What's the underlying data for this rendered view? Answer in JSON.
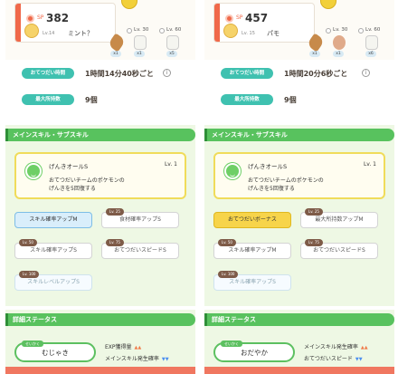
{
  "panels": [
    {
      "header": {
        "sp_label": "SP",
        "sp_value": "382",
        "level": "Lv.14",
        "name": "ミント？"
      },
      "ingredients": [
        {
          "level": "Lv. 30",
          "qty": "x1"
        },
        {
          "level": "Lv. 60",
          "qty": "x5"
        }
      ],
      "first_ingredient_qty": "x1",
      "stats": [
        {
          "label": "おてつだい時間",
          "value": "1時間14分40秒ごと"
        },
        {
          "label": "最大所持数",
          "value": "9個"
        }
      ],
      "skill_section_title": "メインスキル・サブスキル",
      "main_skill": {
        "name": "げんきオールS",
        "level": "Lv. 1",
        "desc1": "おてつだいチームのポケモンの",
        "desc2": "げんきを5回復する"
      },
      "subskills": [
        {
          "tag": "",
          "label": "スキル確率アップM",
          "style": "active-blue"
        },
        {
          "tag": "Lv. 25",
          "label": "食材確率アップS",
          "style": ""
        },
        {
          "tag": "Lv. 50",
          "label": "スキル確率アップS",
          "style": ""
        },
        {
          "tag": "Lv. 75",
          "label": "おてつだいスピードS",
          "style": ""
        },
        {
          "tag": "Lv. 100",
          "label": "スキルレベルアップS",
          "style": "faded"
        }
      ],
      "detail_section_title": "詳細ステータス",
      "nature": {
        "tag": "せいかく",
        "value": "むじゃき"
      },
      "effects": [
        {
          "label": "EXP獲得量",
          "dir": "up"
        },
        {
          "label": "メインスキル発生確率",
          "dir": "down"
        }
      ]
    },
    {
      "header": {
        "sp_label": "SP",
        "sp_value": "457",
        "level": "Lv. 15",
        "name": "パモ"
      },
      "ingredients": [
        {
          "level": "Lv. 30",
          "qty": "x1"
        },
        {
          "level": "Lv. 60",
          "qty": "x6"
        }
      ],
      "first_ingredient_qty": "x1",
      "stats": [
        {
          "label": "おてつだい時間",
          "value": "1時間20分6秒ごと"
        },
        {
          "label": "最大所持数",
          "value": "9個"
        }
      ],
      "skill_section_title": "メインスキル・サブスキル",
      "main_skill": {
        "name": "げんきオールS",
        "level": "Lv. 1",
        "desc1": "おてつだいチームのポケモンの",
        "desc2": "げんきを5回復する"
      },
      "subskills": [
        {
          "tag": "",
          "label": "おてつだいボーナス",
          "style": "active-gold"
        },
        {
          "tag": "Lv. 25",
          "label": "最大所持数アップM",
          "style": ""
        },
        {
          "tag": "Lv. 50",
          "label": "スキル確率アップM",
          "style": ""
        },
        {
          "tag": "Lv. 75",
          "label": "おてつだいスピードS",
          "style": ""
        },
        {
          "tag": "Lv. 100",
          "label": "スキル確率アップS",
          "style": "faded"
        }
      ],
      "detail_section_title": "詳細ステータス",
      "nature": {
        "tag": "せいかく",
        "value": "おだやか"
      },
      "effects": [
        {
          "label": "メインスキル発生確率",
          "dir": "up"
        },
        {
          "label": "おてつだいスピード",
          "dir": "down"
        }
      ]
    }
  ],
  "icons": {
    "up": "▲▲",
    "down": "▼▼",
    "info": "i"
  },
  "colors": {
    "accent_green": "#58c25e",
    "teal": "#3fc1b0",
    "sp_red": "#f0694a",
    "gold": "#f7d44a"
  }
}
